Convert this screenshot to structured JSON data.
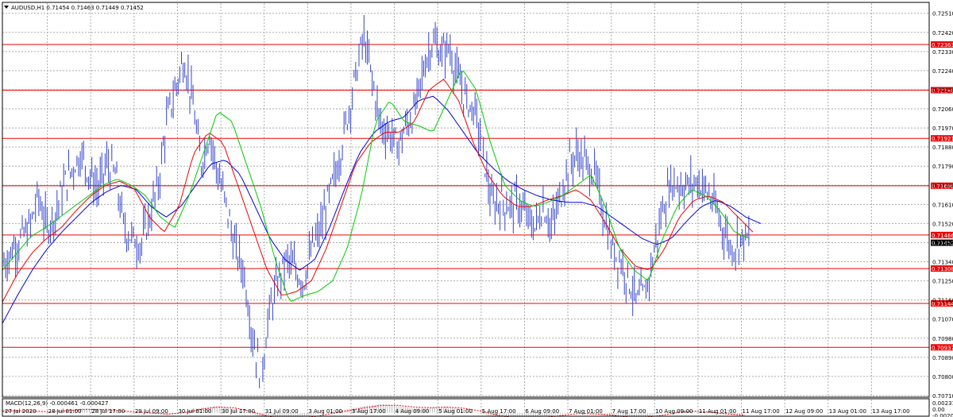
{
  "chart_data": {
    "type": "line",
    "symbol_header": "AUDUSD,H1  0.71454 0.71463 0.71449 0.71452",
    "indicator_header": "MACD(12,26,9) -0.000461 -0.000427",
    "price_axis": {
      "ylim": [
        0.7071,
        0.7255
      ],
      "ticks": [
        0.7251,
        0.7242,
        0.7233,
        0.7224,
        0.7215,
        0.7206,
        0.7197,
        0.7188,
        0.7179,
        0.717,
        0.7161,
        0.7152,
        0.7143,
        0.7134,
        0.7125,
        0.7116,
        0.7107,
        0.7098,
        0.7089,
        0.708,
        0.7071
      ],
      "tick_labels": [
        "0.72510",
        "0.72420",
        "0.72330",
        "0.72240",
        "0.72150",
        "0.72060",
        "0.71970",
        "0.71880",
        "0.71790",
        "0.71700",
        "0.71610",
        "0.71520",
        "0.71430",
        "0.71340",
        "0.71250",
        "0.71160",
        "0.71070",
        "0.70980",
        "0.70890",
        "0.70800",
        "0.70710"
      ]
    },
    "macd_axis": {
      "ylim": [
        -0.00209,
        0.00231
      ],
      "tick_labels": [
        "0.002315",
        "0.00",
        "-0.002098"
      ],
      "ticks": [
        0.00231,
        0.0,
        -0.00209
      ]
    },
    "time_axis": {
      "labels": [
        "27 Jul 2020",
        "28 Jul 01:00",
        "28 Jul 17:00",
        "29 Jul 09:00",
        "30 Jul 01:00",
        "30 Jul 17:00",
        "31 Jul 09:00",
        "3 Aug 01:00",
        "3 Aug 17:00",
        "4 Aug 09:00",
        "5 Aug 01:00",
        "5 Aug 17:00",
        "6 Aug 09:00",
        "7 Aug 01:00",
        "7 Aug 17:00",
        "10 Aug 09:00",
        "11 Aug 01:00",
        "11 Aug 17:00",
        "12 Aug 09:00",
        "13 Aug 01:00",
        "13 Aug 17:00"
      ]
    },
    "horizontal_levels": [
      {
        "value": 0.72363,
        "label": "0.72363"
      },
      {
        "value": 0.72148,
        "label": "0.72148"
      },
      {
        "value": 0.71921,
        "label": "0.71921"
      },
      {
        "value": 0.71698,
        "label": "0.71698"
      },
      {
        "value": 0.71466,
        "label": "0.71466"
      },
      {
        "value": 0.71308,
        "label": "0.71308"
      },
      {
        "value": 0.71144,
        "label": "0.71144"
      },
      {
        "value": 0.70937,
        "label": "0.70937"
      }
    ],
    "current_price": {
      "value": 0.71452,
      "label": "0.71452"
    },
    "price_keypoints": [
      0.7133,
      0.714,
      0.7145,
      0.715,
      0.7165,
      0.715,
      0.7157,
      0.717,
      0.7178,
      0.7185,
      0.7175,
      0.7168,
      0.718,
      0.7175,
      0.715,
      0.7145,
      0.7142,
      0.7155,
      0.717,
      0.72,
      0.7215,
      0.723,
      0.721,
      0.718,
      0.7195,
      0.7175,
      0.716,
      0.714,
      0.713,
      0.71,
      0.708,
      0.711,
      0.7125,
      0.7135,
      0.713,
      0.7125,
      0.714,
      0.715,
      0.7165,
      0.718,
      0.72,
      0.722,
      0.724,
      0.722,
      0.7198,
      0.7195,
      0.7188,
      0.7198,
      0.7205,
      0.7225,
      0.7238,
      0.7232,
      0.7235,
      0.722,
      0.721,
      0.7205,
      0.7185,
      0.716,
      0.7163,
      0.716,
      0.7162,
      0.7155,
      0.715,
      0.716,
      0.715,
      0.7165,
      0.718,
      0.7185,
      0.718,
      0.7175,
      0.7158,
      0.714,
      0.7135,
      0.7125,
      0.7115,
      0.712,
      0.714,
      0.716,
      0.7172,
      0.717,
      0.717,
      0.7172,
      0.7168,
      0.716,
      0.715,
      0.714,
      0.7145,
      0.7145
    ],
    "ma_green_keypoints": [
      0.713,
      0.7138,
      0.7146,
      0.715,
      0.7155,
      0.716,
      0.7165,
      0.717,
      0.7173,
      0.717,
      0.7165,
      0.7155,
      0.715,
      0.7165,
      0.7185,
      0.7205,
      0.72,
      0.718,
      0.716,
      0.7135,
      0.7115,
      0.7118,
      0.712,
      0.7125,
      0.714,
      0.7165,
      0.72,
      0.721,
      0.72,
      0.7198,
      0.7195,
      0.721,
      0.7225,
      0.7215,
      0.719,
      0.717,
      0.7163,
      0.716,
      0.7162,
      0.7165,
      0.717,
      0.7175,
      0.716,
      0.714,
      0.713,
      0.7125,
      0.7145,
      0.716,
      0.7168,
      0.7165,
      0.7158,
      0.7148,
      0.7145
    ],
    "ma_red_keypoints": [
      0.7115,
      0.7128,
      0.7138,
      0.7145,
      0.715,
      0.7158,
      0.7165,
      0.717,
      0.7172,
      0.7168,
      0.7155,
      0.7148,
      0.716,
      0.7185,
      0.7195,
      0.719,
      0.717,
      0.715,
      0.713,
      0.7118,
      0.712,
      0.7125,
      0.714,
      0.716,
      0.718,
      0.719,
      0.7195,
      0.7195,
      0.72,
      0.7215,
      0.722,
      0.721,
      0.719,
      0.7175,
      0.7165,
      0.716,
      0.716,
      0.7163,
      0.7165,
      0.7168,
      0.7163,
      0.7152,
      0.714,
      0.7132,
      0.713,
      0.714,
      0.7155,
      0.7163,
      0.7165,
      0.7162,
      0.7155,
      0.7148
    ],
    "ma_blue_keypoints": [
      0.7105,
      0.7118,
      0.713,
      0.714,
      0.7148,
      0.7155,
      0.7162,
      0.7167,
      0.717,
      0.7168,
      0.716,
      0.7155,
      0.716,
      0.717,
      0.718,
      0.7182,
      0.7175,
      0.716,
      0.7145,
      0.7135,
      0.713,
      0.7135,
      0.715,
      0.7168,
      0.7185,
      0.7195,
      0.72,
      0.7202,
      0.721,
      0.7212,
      0.7205,
      0.7195,
      0.7185,
      0.7178,
      0.7172,
      0.7168,
      0.7165,
      0.7163,
      0.7162,
      0.7162,
      0.716,
      0.7155,
      0.715,
      0.7145,
      0.7142,
      0.7145,
      0.7153,
      0.716,
      0.7163,
      0.716,
      0.7155,
      0.7152
    ],
    "macd_hist_keypoints": [
      0.0006,
      0.0004,
      0.0002,
      0.0,
      0.0005,
      0.0008,
      0.0006,
      0.0003,
      0.0001,
      -0.0002,
      -0.0004,
      0.0002,
      0.0009,
      0.0012,
      0.0007,
      -0.0001,
      -0.001,
      -0.0014,
      -0.0008,
      -0.0003,
      0.0002,
      0.0007,
      0.0012,
      0.0015,
      0.0012,
      0.0008,
      0.0009,
      0.0011,
      0.0006,
      0.0,
      -0.0009,
      -0.0012,
      -0.001,
      -0.0006,
      -0.0002,
      0.0001,
      -0.0002,
      -0.0006,
      -0.0011,
      -0.0008,
      -0.0002,
      0.0004,
      0.0003,
      0.0,
      -0.0003,
      -0.0005
    ],
    "macd_signal_keypoints": [
      0.0003,
      0.0004,
      0.0003,
      0.0002,
      0.0004,
      0.0006,
      0.0006,
      0.0004,
      0.0002,
      0.0,
      -0.0002,
      0.0,
      0.0006,
      0.001,
      0.0009,
      0.0003,
      -0.0005,
      -0.0011,
      -0.001,
      -0.0006,
      -0.0001,
      0.0004,
      0.0009,
      0.0013,
      0.0013,
      0.001,
      0.0009,
      0.001,
      0.0008,
      0.0003,
      -0.0004,
      -0.0009,
      -0.001,
      -0.0008,
      -0.0004,
      -0.0001,
      -0.0002,
      -0.0004,
      -0.0008,
      -0.0008,
      -0.0004,
      0.0001,
      0.0003,
      0.0001,
      -0.0002,
      -0.0004
    ],
    "colors": {
      "price": "#3344cc",
      "ma_green": "#00cc00",
      "ma_red": "#ee0000",
      "ma_blue": "#0000dd",
      "level_line": "#ee0000",
      "level_tag": "#ee0000",
      "grid": "#aaaaaa",
      "macd_hist": "#bbbbbb",
      "macd_signal": "#ee0000"
    },
    "grid": true
  }
}
